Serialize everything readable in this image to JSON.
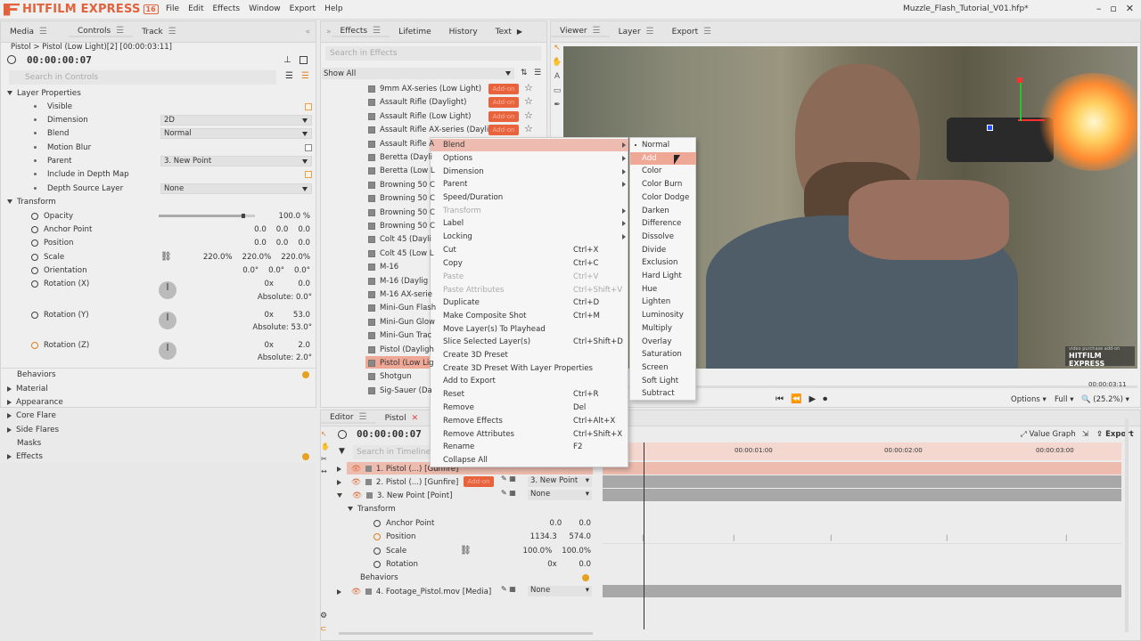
{
  "app": {
    "logo": "HITFILM EXPRESS",
    "version": "16",
    "filename": "Muzzle_Flash_Tutorial_V01.hfp*",
    "menu": [
      "File",
      "Edit",
      "Effects",
      "Window",
      "Export",
      "Help"
    ]
  },
  "left": {
    "tabs": [
      "Media",
      "Controls",
      "Track"
    ],
    "breadcrumb": "Pistol > Pistol (Low Light)[2] [00:00:03:11]",
    "timecode": "00:00:00:07",
    "search_placeholder": "Search in Controls",
    "layer_props": {
      "title": "Layer Properties",
      "visible": "Visible",
      "dimension": "Dimension",
      "dimension_val": "2D",
      "blend": "Blend",
      "blend_val": "Normal",
      "motion_blur": "Motion Blur",
      "parent": "Parent",
      "parent_val": "3. New Point",
      "depth_map": "Include in Depth Map",
      "depth_src": "Depth Source Layer",
      "depth_src_val": "None"
    },
    "transform": {
      "title": "Transform",
      "opacity": "Opacity",
      "opacity_val": "100.0 %",
      "opacity_level": 0.88,
      "anchor": "Anchor Point",
      "anchor_val": "0.0    0.0    0.0",
      "position": "Position",
      "position_val": "0.0    0.0    0.0",
      "scale": "Scale",
      "scale_val": "220.0%    220.0%    220.0%",
      "orientation": "Orientation",
      "orientation_val": "0.0°    0.0°    0.0°",
      "rx": "Rotation (X)",
      "rx_val": "0x          0.0",
      "rx_abs": "Absolute: 0.0°",
      "ry": "Rotation (Y)",
      "ry_val": "0x        53.0",
      "ry_abs": "Absolute: 53.0°",
      "rz": "Rotation (Z)",
      "rz_val": "0x          2.0",
      "rz_abs": "Absolute: 2.0°"
    },
    "sections": [
      "Behaviors",
      "Material",
      "Appearance",
      "Core Flare",
      "Side Flares",
      "Masks",
      "Effects"
    ]
  },
  "effects": {
    "tabs": [
      "Effects",
      "Lifetime",
      "History",
      "Text"
    ],
    "search_placeholder": "Search in Effects",
    "filter": "Show All",
    "addon": "Add-on",
    "items": [
      "9mm AX-series (Low Light)",
      "Assault Rifle (Daylight)",
      "Assault Rifle (Low Light)",
      "Assault Rifle AX-series (Dayli...",
      "Assault Rifle A",
      "Beretta (Dayli",
      "Beretta (Low L",
      "Browning 50 C",
      "Browning 50 C",
      "Browning 50 C",
      "Browning 50 C",
      "Colt 45 (Dayli",
      "Colt 45 (Low L",
      "M-16",
      "M-16 (Daylig",
      "M-16 AX-serie",
      "Mini-Gun Flash",
      "Mini-Gun Glow",
      "Mini-Gun Trac",
      "Pistol (Dayligh",
      "Pistol (Low Lig",
      "Shotgun",
      "Sig-Sauer (Da"
    ]
  },
  "ctx": [
    {
      "l": "Blend",
      "a": 1,
      "hl": 1
    },
    {
      "l": "Options",
      "a": 1
    },
    {
      "l": "Dimension",
      "a": 1
    },
    {
      "l": "Parent",
      "a": 1
    },
    {
      "l": "Speed/Duration"
    },
    {
      "l": "Transform",
      "a": 1,
      "dis": 1
    },
    {
      "l": "Label",
      "a": 1
    },
    {
      "l": "Locking",
      "a": 1
    },
    {
      "l": "Cut",
      "s": "Ctrl+X"
    },
    {
      "l": "Copy",
      "s": "Ctrl+C"
    },
    {
      "l": "Paste",
      "s": "Ctrl+V",
      "dis": 1
    },
    {
      "l": "Paste Attributes",
      "s": "Ctrl+Shift+V",
      "dis": 1
    },
    {
      "l": "Duplicate",
      "s": "Ctrl+D"
    },
    {
      "l": "Make Composite Shot",
      "s": "Ctrl+M"
    },
    {
      "l": "Move Layer(s) To Playhead"
    },
    {
      "l": "Slice Selected Layer(s)",
      "s": "Ctrl+Shift+D"
    },
    {
      "l": "Create 3D Preset"
    },
    {
      "l": "Create 3D Preset With Layer Properties"
    },
    {
      "l": "Add to Export"
    },
    {
      "l": "Reset",
      "s": "Ctrl+R"
    },
    {
      "l": "Remove",
      "s": "Del"
    },
    {
      "l": "Remove Effects",
      "s": "Ctrl+Alt+X"
    },
    {
      "l": "Remove Attributes",
      "s": "Ctrl+Shift+X"
    },
    {
      "l": "Rename",
      "s": "F2"
    },
    {
      "l": "Collapse All"
    }
  ],
  "blend_modes": [
    "Normal",
    "Add",
    "Color",
    "Color Burn",
    "Color Dodge",
    "Darken",
    "Difference",
    "Dissolve",
    "Divide",
    "Exclusion",
    "Hard Light",
    "Hue",
    "Lighten",
    "Luminosity",
    "Multiply",
    "Overlay",
    "Saturation",
    "Screen",
    "Soft Light",
    "Subtract"
  ],
  "viewer": {
    "tabs": [
      "Viewer",
      "Layer",
      "Export"
    ],
    "time": "00:00:03:11",
    "options": "Options",
    "full": "Full",
    "zoom": "(25.2%)",
    "watermark_small": "video purchase add-on",
    "watermark": "HITFILM EXPRESS"
  },
  "editor": {
    "tabs": [
      "Editor",
      "Pistol"
    ],
    "timecode": "00:00:00:07",
    "value_graph": "Value Graph",
    "export": "Export",
    "search_placeholder": "Search in Timeline",
    "ticks": [
      "00:00:01:00",
      "00:00:02:00",
      "00:00:03:00"
    ],
    "layers": [
      {
        "name": "1. Pistol (...) [Gunfire]",
        "parent": "3. New Point"
      },
      {
        "name": "2. Pistol (...) [Gunfire]",
        "parent": "3. New Point"
      },
      {
        "name": "3. New Point [Point]",
        "parent": "None"
      }
    ],
    "transform": "Transform",
    "anchor": "Anchor Point",
    "anchor_val": "0.0       0.0",
    "position": "Position",
    "position_val": "1134.3     574.0",
    "scale": "Scale",
    "scale_val": "100.0%    100.0%",
    "rotation": "Rotation",
    "rotation_val": "0x         0.0",
    "behaviors": "Behaviors",
    "footage": "4. Footage_Pistol.mov [Media]",
    "footage_parent": "None"
  }
}
